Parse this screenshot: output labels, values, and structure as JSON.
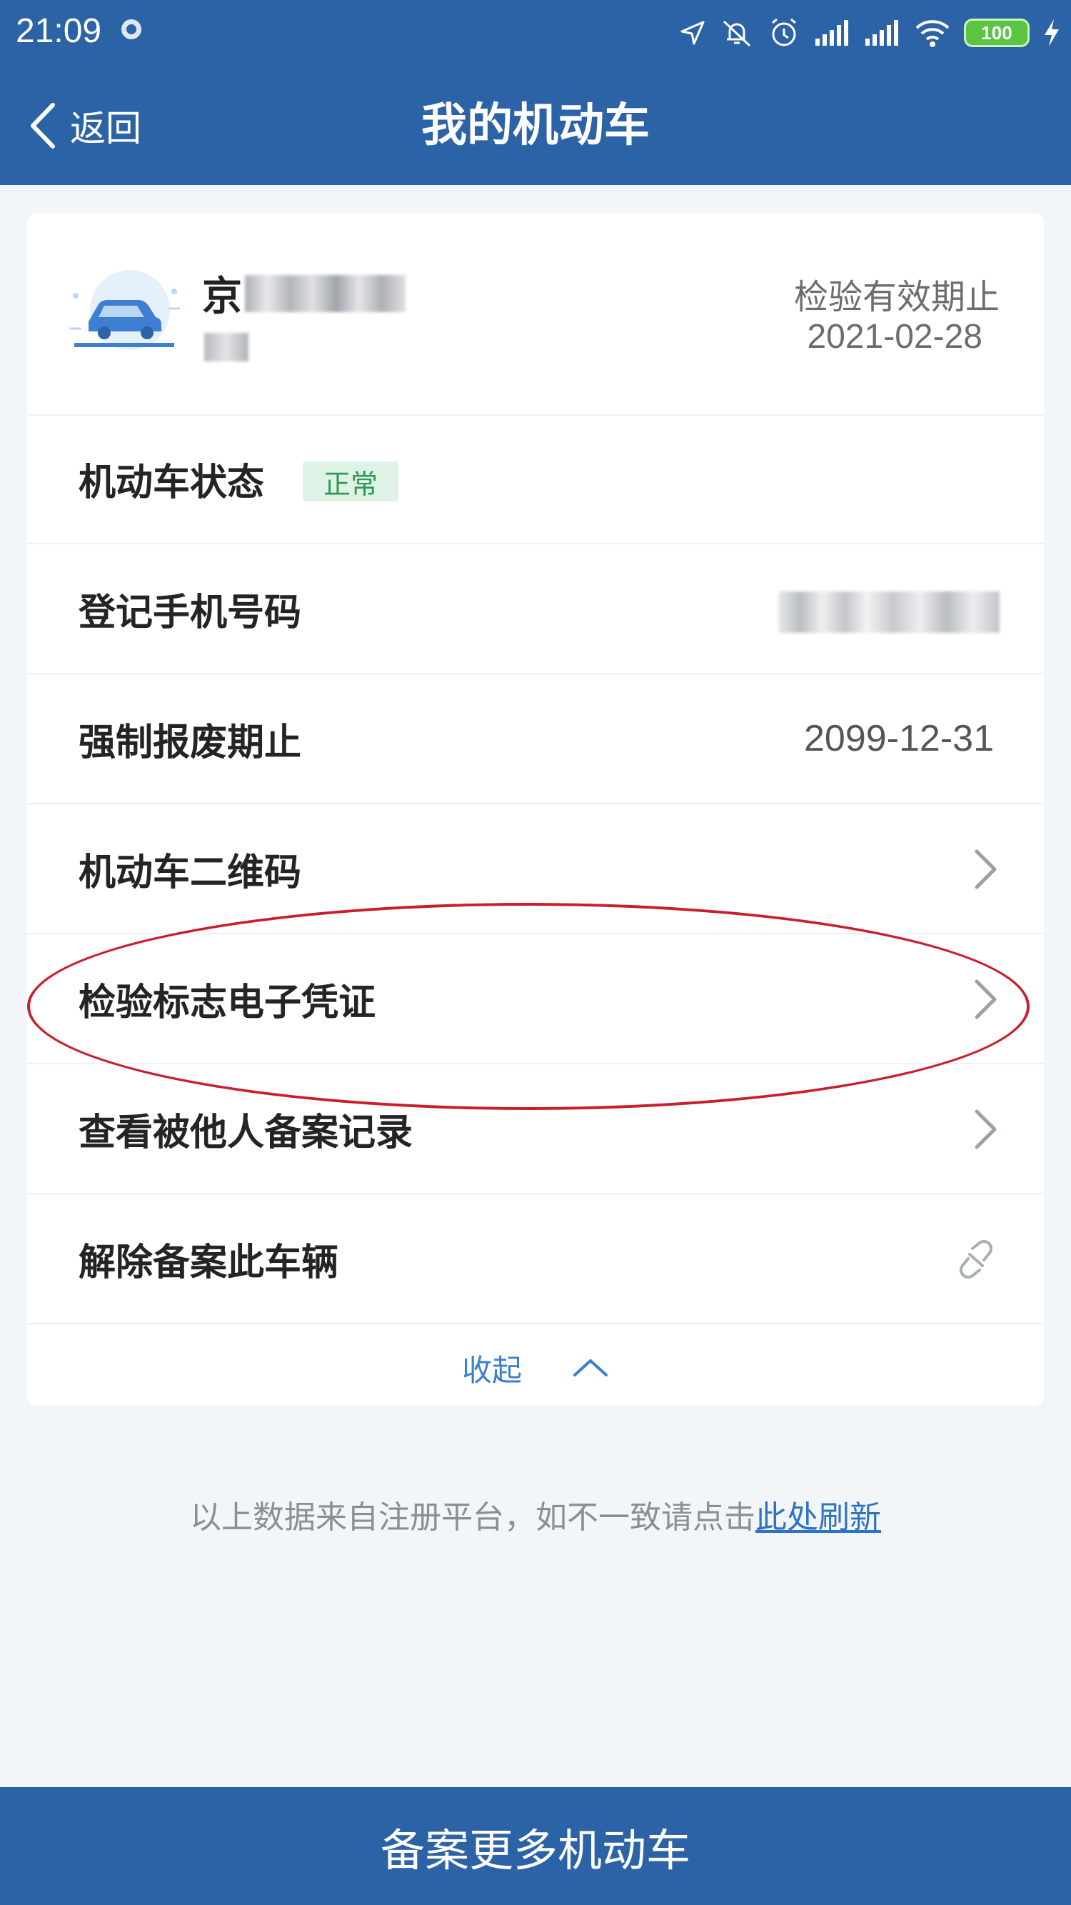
{
  "status_bar": {
    "time": "21:09",
    "battery": "100",
    "icons": [
      "location-icon",
      "mute-icon",
      "alarm-icon",
      "signal-icon",
      "signal-icon",
      "wifi-icon",
      "battery-icon",
      "charging-icon"
    ]
  },
  "header": {
    "back_label": "返回",
    "title": "我的机动车"
  },
  "vehicle": {
    "plate_prefix": "京",
    "inspection_label": "检验有效期止",
    "inspection_date": "2021-02-28"
  },
  "rows": [
    {
      "label": "机动车状态",
      "badge": "正常"
    },
    {
      "label": "登记手机号码"
    },
    {
      "label": "强制报废期止",
      "value": "2099-12-31"
    },
    {
      "label": "机动车二维码"
    },
    {
      "label": "检验标志电子凭证"
    },
    {
      "label": "查看被他人备案记录"
    },
    {
      "label": "解除备案此车辆"
    }
  ],
  "collapse_label": "收起",
  "footnote": {
    "text": "以上数据来自注册平台，如不一致请点击",
    "link": "此处刷新"
  },
  "bottom_button": "备案更多机动车",
  "colors": {
    "brand": "#2c63a7",
    "status_badge_text": "#2f9a57",
    "annotation": "#c91f2c"
  }
}
